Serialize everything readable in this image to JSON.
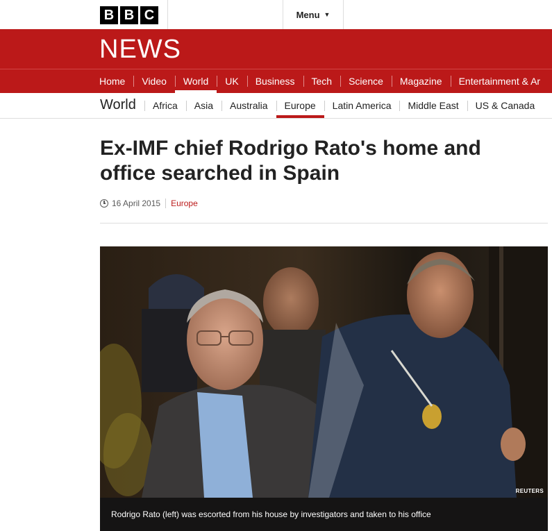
{
  "header": {
    "logo_letters": [
      "B",
      "B",
      "C"
    ],
    "menu_label": "Menu",
    "masthead": "NEWS"
  },
  "nav": {
    "items": [
      {
        "label": "Home"
      },
      {
        "label": "Video"
      },
      {
        "label": "World",
        "active": true
      },
      {
        "label": "UK"
      },
      {
        "label": "Business"
      },
      {
        "label": "Tech"
      },
      {
        "label": "Science"
      },
      {
        "label": "Magazine"
      },
      {
        "label": "Entertainment & Ar"
      }
    ]
  },
  "subnav": {
    "title": "World",
    "items": [
      {
        "label": "Africa"
      },
      {
        "label": "Asia"
      },
      {
        "label": "Australia"
      },
      {
        "label": "Europe",
        "active": true
      },
      {
        "label": "Latin America"
      },
      {
        "label": "Middle East"
      },
      {
        "label": "US & Canada"
      }
    ]
  },
  "article": {
    "headline": "Ex-IMF chief Rodrigo Rato's home and office searched in Spain",
    "date": "16 April 2015",
    "section": "Europe",
    "image": {
      "credit": "REUTERS",
      "caption": "Rodrigo Rato (left) was escorted from his house by investigators and taken to his office"
    }
  },
  "colors": {
    "brand_red": "#bb1919",
    "text": "#222222"
  }
}
